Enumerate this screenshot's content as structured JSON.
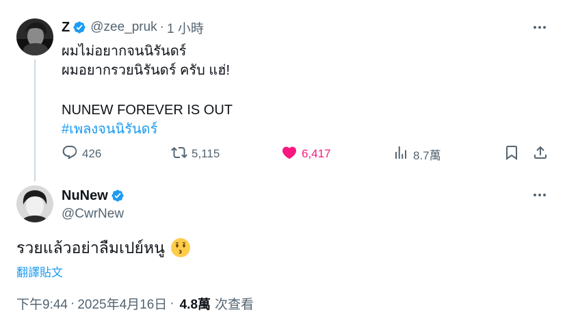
{
  "colors": {
    "accent": "#1d9bf0",
    "like": "#f91880",
    "secondary": "#536471",
    "text": "#0f1419"
  },
  "tweet1": {
    "name": "Z",
    "handle": "@zee_pruk",
    "separator": "·",
    "time": "1 小時",
    "lines": [
      "ผมไม่อยากจนนิรันดร์",
      "ผมอยากรวยนิรันดร์ ครับ แฮ่!",
      "NUNEW FOREVER IS OUT"
    ],
    "hashtag": "#เพลงจนนิรันดร์",
    "counts": {
      "replies": "426",
      "retweets": "5,115",
      "likes": "6,417",
      "views": "8.7萬"
    },
    "icons": [
      "verified-icon",
      "more-icon",
      "reply-icon",
      "retweet-icon",
      "like-icon",
      "views-icon",
      "bookmark-icon",
      "share-icon"
    ]
  },
  "tweet2": {
    "name": "NuNew",
    "handle": "@CwrNew",
    "text": "รวยแล้วอย่าลืมเปย์หนู",
    "emoji": "kissing-face-emoji",
    "translate": "翻譯貼文",
    "time": "下午9:44",
    "date": "2025年4月16日",
    "separator": "·",
    "views_count": "4.8萬",
    "views_label": "次查看"
  }
}
